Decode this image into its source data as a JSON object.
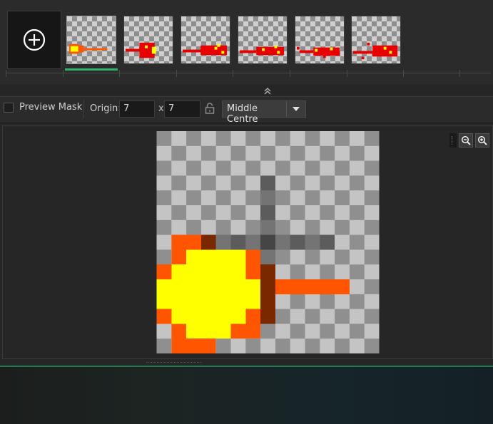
{
  "strip": {
    "add_icon": "plus-circle-icon",
    "frames": [
      {
        "name": "frame-1",
        "selected": true
      },
      {
        "name": "frame-2",
        "selected": false
      },
      {
        "name": "frame-3",
        "selected": false
      },
      {
        "name": "frame-4",
        "selected": false
      },
      {
        "name": "frame-5",
        "selected": false
      },
      {
        "name": "frame-6",
        "selected": false
      }
    ],
    "collapse_icon": "double-chevron-up-icon"
  },
  "toolbar": {
    "preview_mask_label": "Preview Mask",
    "preview_mask_checked": false,
    "origin_label": "Origin:",
    "origin_x": "7",
    "x_separator": "x",
    "origin_y": "7",
    "lock_icon": "unlock-icon",
    "origin_preset": "Middle Centre",
    "dropdown_icon": "triangle-down-icon"
  },
  "canvas": {
    "zoom_out_icon": "zoom-out-icon",
    "zoom_in_icon": "zoom-in-icon"
  },
  "colors": {
    "accent": "#2fb36f",
    "fire_yellow": "#ffff00",
    "fire_orange": "#ff5500",
    "fire_red": "#e80000",
    "fire_dark": "#7a2800"
  }
}
